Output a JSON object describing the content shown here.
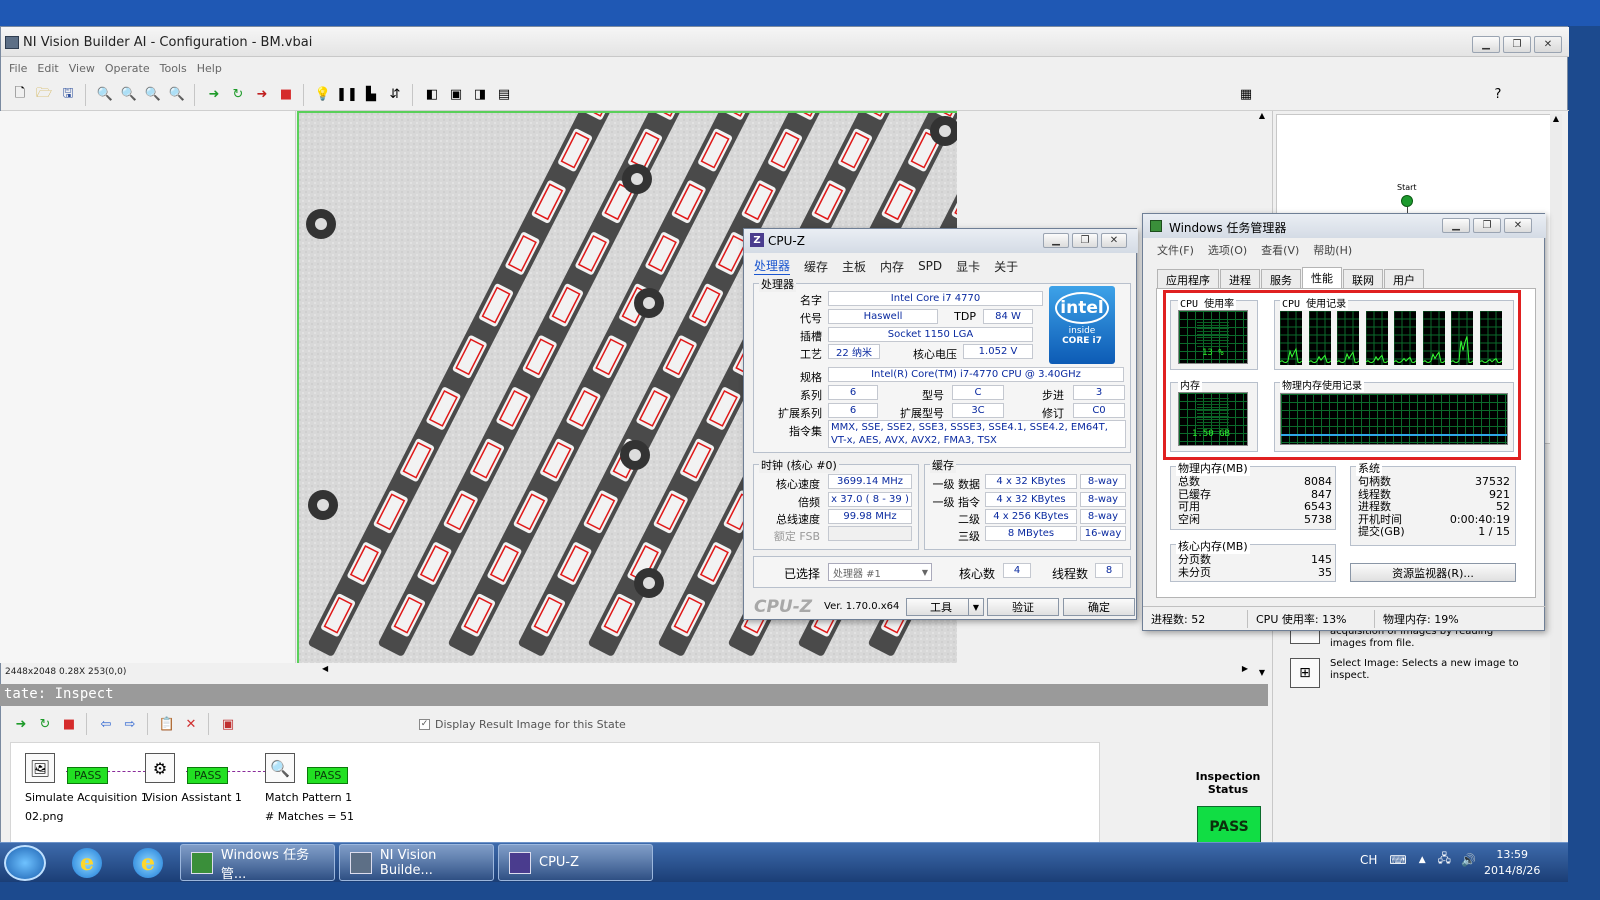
{
  "desktop": {
    "accent": "#1c4a8e"
  },
  "nvb": {
    "title": "NI Vision Builder AI - Configuration - BM.vbai",
    "menu": [
      "File",
      "Edit",
      "View",
      "Operate",
      "Tools",
      "Help"
    ],
    "image_status": "2448x2048 0.28X 253",
    "image_coord": "(0,0)",
    "state_label": "tate:  Inspect",
    "display_result_label": "Display Result Image for this State",
    "steps": [
      {
        "name": "Simulate Acquisition 1",
        "sub": "02.png",
        "result": "PASS"
      },
      {
        "name": "Vision Assistant 1",
        "sub": "",
        "result": "PASS"
      },
      {
        "name": "Match Pattern 1",
        "sub": "# Matches = 51",
        "result": "PASS"
      }
    ],
    "inspection_status_label": "Inspection Status",
    "inspection_status": "PASS",
    "flow_start": "Start",
    "palette": [
      {
        "title": "",
        "desc": "acquisition of images by reading images from file."
      },
      {
        "title": "Select Image:",
        "desc": "Selects a new image to inspect."
      }
    ]
  },
  "cpuz": {
    "title": "CPU-Z",
    "tabs": [
      "处理器",
      "缓存",
      "主板",
      "内存",
      "SPD",
      "显卡",
      "关于"
    ],
    "processor_group": "处理器",
    "name_label": "名字",
    "name": "Intel Core i7 4770",
    "codename_label": "代号",
    "codename": "Haswell",
    "tdp_label": "TDP",
    "tdp": "84 W",
    "package_label": "插槽",
    "package": "Socket 1150 LGA",
    "tech_label": "工艺",
    "tech": "22 纳米",
    "voltage_label": "核心电压",
    "voltage": "1.052 V",
    "spec_label": "规格",
    "spec": "Intel(R) Core(TM) i7-4770 CPU @ 3.40GHz",
    "family_label": "系列",
    "family": "6",
    "model_label": "型号",
    "model": "C",
    "stepping_label": "步进",
    "stepping": "3",
    "extfamily_label": "扩展系列",
    "extfamily": "6",
    "extmodel_label": "扩展型号",
    "extmodel": "3C",
    "revision_label": "修订",
    "revision": "C0",
    "instr_label": "指令集",
    "instr": "MMX, SSE, SSE2, SSE3, SSSE3, SSE4.1, SSE4.2, EM64T, VT-x, AES, AVX, AVX2, FMA3, TSX",
    "clock_group": "时钟 (核心 #0)",
    "core_speed_label": "核心速度",
    "core_speed": "3699.14 MHz",
    "multiplier_label": "倍频",
    "multiplier": "x 37.0 ( 8 - 39 )",
    "bus_speed_label": "总线速度",
    "bus_speed": "99.98 MHz",
    "fsb_label": "额定 FSB",
    "fsb": "",
    "cache_group": "缓存",
    "l1d_label": "一级 数据",
    "l1d": "4 x 32 KBytes",
    "l1d_way": "8-way",
    "l1i_label": "一级 指令",
    "l1i": "4 x 32 KBytes",
    "l1i_way": "8-way",
    "l2_label": "二级",
    "l2": "4 x 256 KBytes",
    "l2_way": "8-way",
    "l3_label": "三级",
    "l3": "8 MBytes",
    "l3_way": "16-way",
    "select_label": "已选择",
    "select": "处理器 #1",
    "cores_label": "核心数",
    "cores": "4",
    "threads_label": "线程数",
    "threads": "8",
    "brand": "CPU-Z",
    "version": "Ver. 1.70.0.x64",
    "tools_btn": "工具",
    "validate_btn": "验证",
    "ok_btn": "确定",
    "intel_logo": "intel",
    "intel_inside": "inside",
    "intel_core": "CORE i7"
  },
  "taskmgr": {
    "title": "Windows 任务管理器",
    "menu": [
      "文件(F)",
      "选项(O)",
      "查看(V)",
      "帮助(H)"
    ],
    "tabs": [
      "应用程序",
      "进程",
      "服务",
      "性能",
      "联网",
      "用户"
    ],
    "cpu_usage_label": "CPU 使用率",
    "cpu_usage": "13 %",
    "cpu_history_label": "CPU 使用记录",
    "mem_label": "内存",
    "mem": "1.50 GB",
    "mem_history_label": "物理内存使用记录",
    "phys_group": "物理内存(MB)",
    "phys_rows": [
      [
        "总数",
        "8084"
      ],
      [
        "已缓存",
        "847"
      ],
      [
        "可用",
        "6543"
      ],
      [
        "空闲",
        "5738"
      ]
    ],
    "sys_group": "系统",
    "sys_rows": [
      [
        "句柄数",
        "37532"
      ],
      [
        "线程数",
        "921"
      ],
      [
        "进程数",
        "52"
      ],
      [
        "开机时间",
        "0:00:40:19"
      ],
      [
        "提交(GB)",
        "1 / 15"
      ]
    ],
    "kernel_group": "核心内存(MB)",
    "kernel_rows": [
      [
        "分页数",
        "145"
      ],
      [
        "未分页",
        "35"
      ]
    ],
    "resmon_btn": "资源监视器(R)...",
    "status_procs": "进程数: 52",
    "status_cpu": "CPU 使用率: 13%",
    "status_mem": "物理内存: 19%"
  },
  "taskbar": {
    "tasks": [
      "Windows 任务管...",
      "NI Vision Builde...",
      "CPU-Z"
    ],
    "tray": "CH",
    "time": "13:59",
    "date": "2014/8/26"
  }
}
